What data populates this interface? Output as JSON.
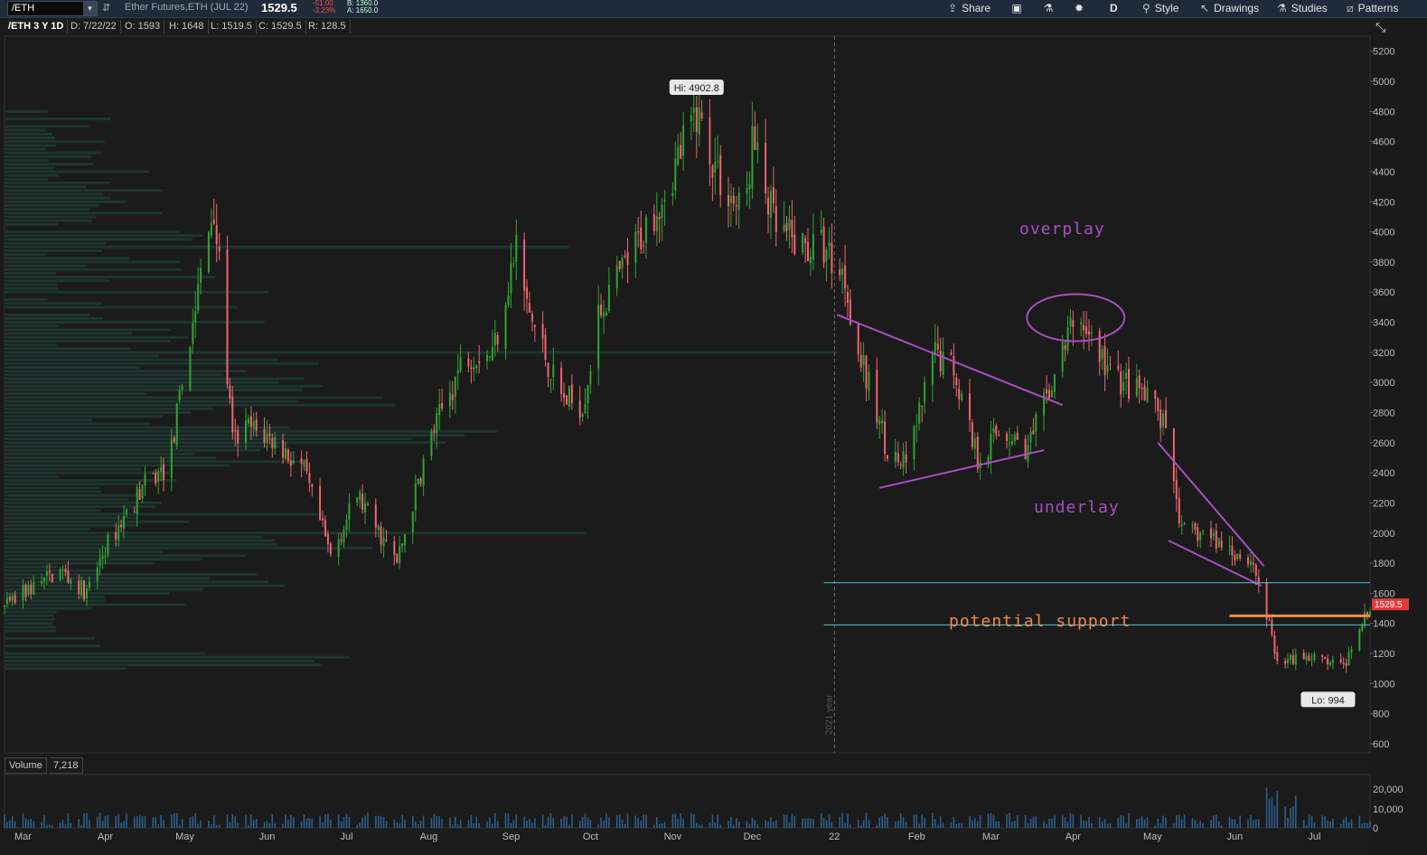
{
  "header": {
    "symbol": "/ETH",
    "description": "Ether Futures,ETH (JUL 22)",
    "last": "1529.5",
    "change": "-51.00",
    "change_pct": "-3.23%",
    "bid": "B: 1360.0",
    "ask": "A: 1650.0"
  },
  "toolbar": {
    "share": "Share",
    "period": "D",
    "style": "Style",
    "drawings": "Drawings",
    "studies": "Studies",
    "patterns": "Patterns"
  },
  "info": {
    "title": "/ETH 3 Y 1D",
    "date": "D: 7/22/22",
    "open": "O: 1593",
    "high": "H: 1648",
    "low": "L: 1519.5",
    "close": "C: 1529.5",
    "range": "R: 128.5"
  },
  "volume_label": "Volume",
  "volume_value": "7,218",
  "colors": {
    "up": "#2fa531",
    "down": "#f0656d",
    "profile": "#1e3a33",
    "purple": "#a84fc2",
    "cyan": "#56c7d1",
    "orange": "#f08a50",
    "background": "#1b1b1b"
  },
  "chart_data": {
    "type": "candlestick",
    "price_ticks": [
      5200,
      5000,
      4800,
      4600,
      4400,
      4200,
      4000,
      3800,
      3600,
      3400,
      3200,
      3000,
      2800,
      2600,
      2400,
      2200,
      2000,
      1800,
      1600,
      1400,
      1200,
      1000,
      800,
      600
    ],
    "ylim": [
      540,
      5300
    ],
    "x_labels": [
      "Mar",
      "Apr",
      "May",
      "Jun",
      "Jul",
      "Aug",
      "Sep",
      "Oct",
      "Nov",
      "Dec",
      "22",
      "Feb",
      "Mar",
      "Apr",
      "May",
      "Jun",
      "Jul"
    ],
    "x_range": [
      "2021-02-22",
      "2022-07-22"
    ],
    "x_label_dates": [
      "2021-03-01",
      "2021-04-01",
      "2021-05-01",
      "2021-06-01",
      "2021-07-01",
      "2021-08-01",
      "2021-09-01",
      "2021-10-01",
      "2021-11-01",
      "2021-12-01",
      "2022-01-01",
      "2022-02-01",
      "2022-03-01",
      "2022-04-01",
      "2022-05-01",
      "2022-06-01",
      "2022-07-01"
    ],
    "close_path": [
      [
        "2021-02-22",
        1500
      ],
      [
        "2021-03-01",
        1600
      ],
      [
        "2021-03-15",
        1750
      ],
      [
        "2021-03-25",
        1600
      ],
      [
        "2021-04-01",
        1900
      ],
      [
        "2021-04-15",
        2300
      ],
      [
        "2021-04-25",
        2450
      ],
      [
        "2021-05-03",
        3300
      ],
      [
        "2021-05-10",
        4000
      ],
      [
        "2021-05-12",
        4200
      ],
      [
        "2021-05-19",
        2600
      ],
      [
        "2021-05-25",
        2700
      ],
      [
        "2021-06-05",
        2600
      ],
      [
        "2021-06-15",
        2400
      ],
      [
        "2021-06-25",
        1850
      ],
      [
        "2021-07-05",
        2250
      ],
      [
        "2021-07-20",
        1800
      ],
      [
        "2021-08-01",
        2600
      ],
      [
        "2021-08-15",
        3200
      ],
      [
        "2021-08-25",
        3200
      ],
      [
        "2021-09-03",
        3900
      ],
      [
        "2021-09-07",
        3500
      ],
      [
        "2021-09-20",
        2900
      ],
      [
        "2021-09-28",
        2850
      ],
      [
        "2021-10-05",
        3500
      ],
      [
        "2021-10-15",
        3800
      ],
      [
        "2021-10-25",
        4150
      ],
      [
        "2021-11-01",
        4400
      ],
      [
        "2021-11-10",
        4800
      ],
      [
        "2021-11-20",
        4300
      ],
      [
        "2021-11-28",
        4100
      ],
      [
        "2021-12-01",
        4600
      ],
      [
        "2021-12-10",
        4000
      ],
      [
        "2021-12-20",
        3900
      ],
      [
        "2021-12-28",
        3900
      ],
      [
        "2022-01-05",
        3700
      ],
      [
        "2022-01-10",
        3200
      ],
      [
        "2022-01-22",
        2500
      ],
      [
        "2022-01-28",
        2450
      ],
      [
        "2022-02-08",
        3200
      ],
      [
        "2022-02-15",
        3100
      ],
      [
        "2022-02-24",
        2500
      ],
      [
        "2022-03-05",
        2700
      ],
      [
        "2022-03-15",
        2550
      ],
      [
        "2022-03-25",
        3050
      ],
      [
        "2022-04-02",
        3450
      ],
      [
        "2022-04-08",
        3300
      ],
      [
        "2022-04-15",
        3050
      ],
      [
        "2022-04-25",
        2950
      ],
      [
        "2022-05-03",
        2800
      ],
      [
        "2022-05-07",
        2600
      ],
      [
        "2022-05-12",
        2000
      ],
      [
        "2022-05-20",
        2000
      ],
      [
        "2022-05-30",
        1900
      ],
      [
        "2022-06-08",
        1800
      ],
      [
        "2022-06-13",
        1450
      ],
      [
        "2022-06-18",
        1100
      ],
      [
        "2022-06-25",
        1200
      ],
      [
        "2022-07-05",
        1150
      ],
      [
        "2022-07-12",
        1100
      ],
      [
        "2022-07-18",
        1400
      ],
      [
        "2022-07-22",
        1529.5
      ]
    ],
    "annotations": {
      "hi_label": "Hi: 4902.8",
      "hi": {
        "date": "2021-11-10",
        "price": 4902.8
      },
      "lo_label": "Lo: 994",
      "lo": {
        "date": "2022-06-30",
        "price": 994
      },
      "year_marker": "2021 year",
      "year_marker_date": "2022-01-01",
      "last_price_label": "1529.5",
      "overplay_text": "overplay",
      "underlay_text": "underlay",
      "support_text": "potential support",
      "trendlines": [
        {
          "from": [
            "2022-01-02",
            3450
          ],
          "to": [
            "2022-03-28",
            2850
          ],
          "color": "purple"
        },
        {
          "from": [
            "2022-01-18",
            2300
          ],
          "to": [
            "2022-03-21",
            2550
          ],
          "color": "purple"
        },
        {
          "from": [
            "2022-05-03",
            2600
          ],
          "to": [
            "2022-06-12",
            1780
          ],
          "color": "purple"
        },
        {
          "from": [
            "2022-05-07",
            1950
          ],
          "to": [
            "2022-06-11",
            1650
          ],
          "color": "purple"
        }
      ],
      "ellipse": {
        "date": "2022-04-02",
        "price": 3430
      },
      "support_lines": [
        {
          "price": 1670,
          "from": "2021-12-28",
          "color": "cyan"
        },
        {
          "price": 1390,
          "from": "2021-12-28",
          "color": "cyan"
        },
        {
          "price": 1450,
          "from": "2022-05-30",
          "color": "orange"
        }
      ]
    },
    "volume_ticks": [
      "20,000",
      "10,000",
      "0"
    ]
  }
}
